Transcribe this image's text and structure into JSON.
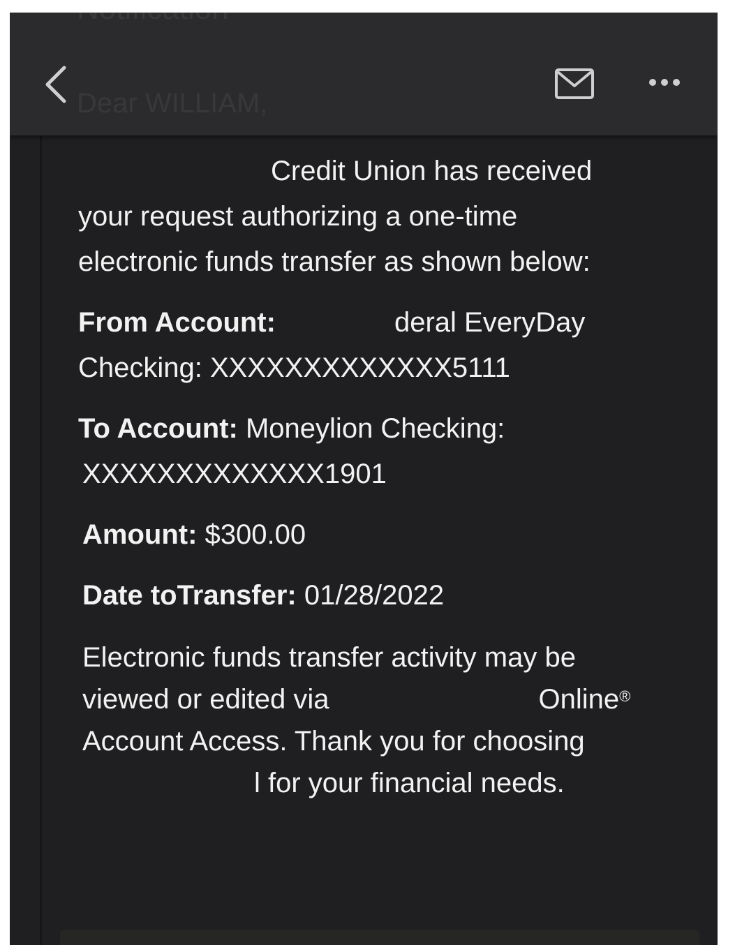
{
  "header": {
    "ghost_title": "Notification",
    "ghost_greeting": "Dear WILLIAM,",
    "icons": {
      "back": "chevron-left-icon",
      "mail": "envelope-icon",
      "more": "ellipsis-icon"
    }
  },
  "email": {
    "intro_line1": "Credit Union has received",
    "intro_line2": "your request authorizing a one-time",
    "intro_line3": "electronic funds transfer as shown below:",
    "from_label": "From Account:",
    "from_value_1": "deral EveryDay",
    "from_value_2": "Checking: XXXXXXXXXXXXX5111",
    "to_label": "To Account:",
    "to_value_1": "Moneylion Checking:",
    "to_value_2": "XXXXXXXXXXXXX1901",
    "amount_label": "Amount:",
    "amount_value": "$300.00",
    "date_label": "Date toTransfer:",
    "date_value": "01/28/2022",
    "closing_line1": "Electronic funds transfer activity may be",
    "closing_line2a": "viewed or edited via",
    "closing_line2b": "Online",
    "closing_reg": "®",
    "closing_line3": "Account Access. Thank you for choosing",
    "closing_line4": "l for your financial needs."
  },
  "colors": {
    "background": "#1f1f21",
    "header": "#2b2b2d",
    "text": "#f2f2f2",
    "icon": "#cfcfd2"
  }
}
